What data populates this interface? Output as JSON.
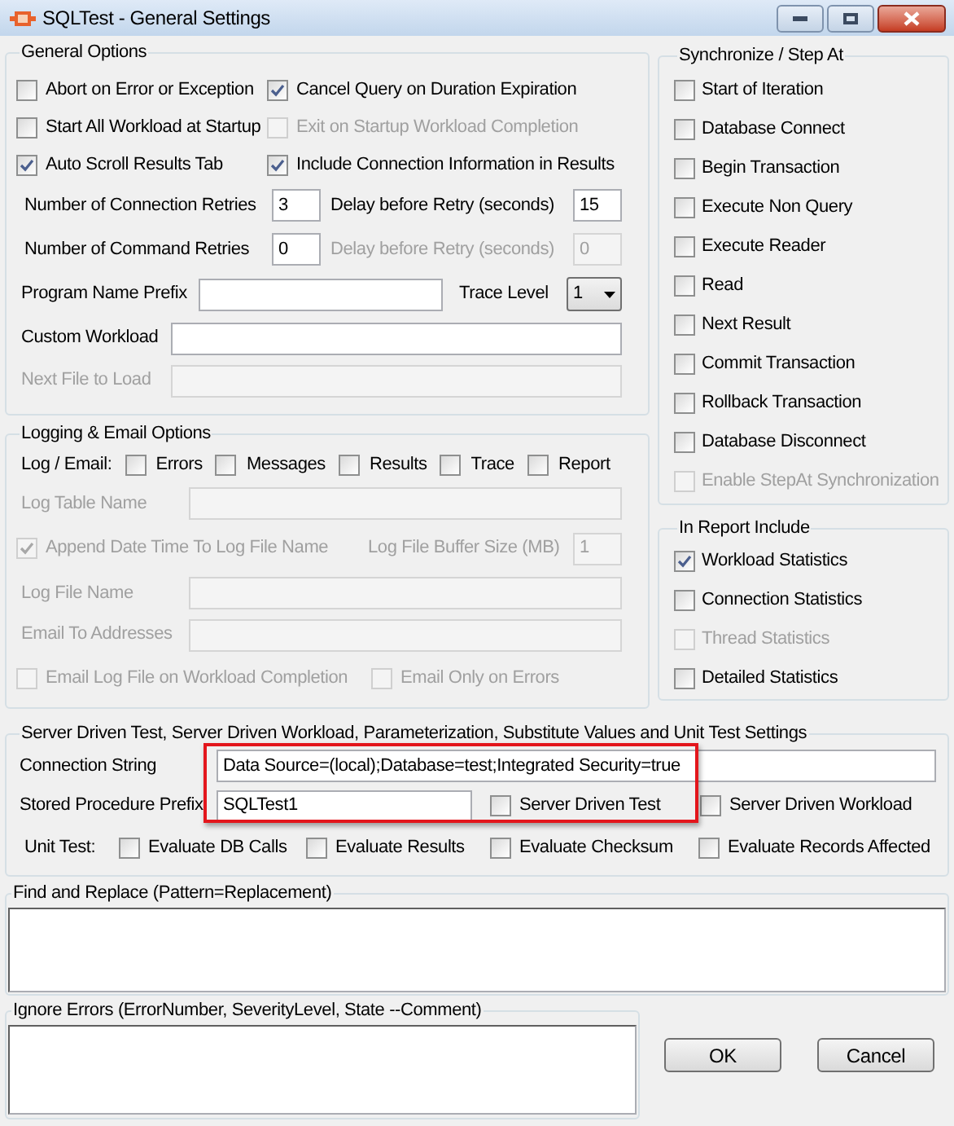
{
  "window": {
    "title": "SQLTest - General Settings"
  },
  "general_options": {
    "title": "General Options",
    "checkboxes": [
      {
        "label": "Abort on Error or Exception",
        "checked": false,
        "disabled": false
      },
      {
        "label": "Cancel Query on Duration Expiration",
        "checked": true,
        "disabled": false
      },
      {
        "label": "Start All Workload at Startup",
        "checked": false,
        "disabled": false
      },
      {
        "label": "Exit on Startup Workload Completion",
        "checked": false,
        "disabled": true
      },
      {
        "label": "Auto Scroll Results Tab",
        "checked": true,
        "disabled": false
      },
      {
        "label": "Include Connection Information in Results",
        "checked": true,
        "disabled": false
      }
    ],
    "connection_retries": {
      "label": "Number of Connection Retries",
      "value": "3",
      "disabled": false
    },
    "connection_retry_delay": {
      "label": "Delay before Retry (seconds)",
      "value": "15",
      "disabled": false
    },
    "command_retries": {
      "label": "Number of Command Retries",
      "value": "0",
      "disabled": false
    },
    "command_retry_delay": {
      "label": "Delay before Retry (seconds)",
      "value": "0",
      "disabled": true
    },
    "program_name_prefix": {
      "label": "Program Name Prefix",
      "disabled": false
    },
    "trace_level": {
      "label": "Trace Level",
      "value": "1"
    },
    "custom_workload": {
      "label": "Custom Workload",
      "disabled": false
    },
    "next_file_to_load": {
      "label": "Next File to Load",
      "disabled": true
    }
  },
  "logging": {
    "title": "Logging & Email Options",
    "log_email": {
      "label": "Log / Email:",
      "options": [
        {
          "label": "Errors",
          "checked": false,
          "disabled": false
        },
        {
          "label": "Messages",
          "checked": false,
          "disabled": false
        },
        {
          "label": "Results",
          "checked": false,
          "disabled": false
        },
        {
          "label": "Trace",
          "checked": false,
          "disabled": false
        },
        {
          "label": "Report",
          "checked": false,
          "disabled": false
        }
      ]
    },
    "log_table_name": {
      "label": "Log Table Name",
      "disabled": true
    },
    "append_date_time": {
      "label": "Append Date Time To Log File Name",
      "checked": true,
      "disabled": true
    },
    "log_file_buffer_size": {
      "label": "Log File Buffer Size (MB)",
      "value": "1",
      "disabled": true
    },
    "log_file_name": {
      "label": "Log File Name",
      "disabled": true
    },
    "email_to_addresses": {
      "label": "Email To Addresses",
      "disabled": true
    },
    "email_log_file": {
      "label": "Email Log File on Workload Completion",
      "checked": false,
      "disabled": true
    },
    "email_only_on_errors": {
      "label": "Email Only on Errors",
      "checked": false,
      "disabled": true
    }
  },
  "synchronize": {
    "title": "Synchronize / Step At",
    "items": [
      {
        "label": "Start of Iteration",
        "checked": false,
        "disabled": false
      },
      {
        "label": "Database Connect",
        "checked": false,
        "disabled": false
      },
      {
        "label": "Begin Transaction",
        "checked": false,
        "disabled": false
      },
      {
        "label": "Execute Non Query",
        "checked": false,
        "disabled": false
      },
      {
        "label": "Execute Reader",
        "checked": false,
        "disabled": false
      },
      {
        "label": "Read",
        "checked": false,
        "disabled": false
      },
      {
        "label": "Next Result",
        "checked": false,
        "disabled": false
      },
      {
        "label": "Commit Transaction",
        "checked": false,
        "disabled": false
      },
      {
        "label": "Rollback Transaction",
        "checked": false,
        "disabled": false
      },
      {
        "label": "Database Disconnect",
        "checked": false,
        "disabled": false
      },
      {
        "label": "Enable StepAt Synchronization",
        "checked": false,
        "disabled": true
      }
    ]
  },
  "report_include": {
    "title": "In Report Include",
    "items": [
      {
        "label": "Workload Statistics",
        "checked": true,
        "disabled": false
      },
      {
        "label": "Connection Statistics",
        "checked": false,
        "disabled": false
      },
      {
        "label": "Thread Statistics",
        "checked": false,
        "disabled": true
      },
      {
        "label": "Detailed Statistics",
        "checked": false,
        "disabled": false
      }
    ]
  },
  "server_driven": {
    "title": "Server Driven Test, Server Driven Workload, Parameterization, Substitute Values and Unit Test Settings",
    "connection_string": {
      "label": "Connection String",
      "value": "Data Source=(local);Database=test;Integrated Security=true",
      "disabled": false
    },
    "stored_procedure_prefix": {
      "label": "Stored Procedure Prefix",
      "value": "SQLTest1",
      "disabled": false
    },
    "server_driven_test": {
      "label": "Server Driven Test",
      "checked": false,
      "disabled": false
    },
    "server_driven_workload": {
      "label": "Server Driven Workload",
      "checked": false,
      "disabled": false
    },
    "unit_test": {
      "label": "Unit Test:",
      "options": [
        {
          "label": "Evaluate DB Calls",
          "checked": false,
          "disabled": false
        },
        {
          "label": "Evaluate Results",
          "checked": false,
          "disabled": false
        },
        {
          "label": "Evaluate Checksum",
          "checked": false,
          "disabled": false
        },
        {
          "label": "Evaluate Records Affected",
          "checked": false,
          "disabled": false
        }
      ]
    }
  },
  "find_and_replace": {
    "title": "Find and Replace (Pattern=Replacement)"
  },
  "ignore_errors": {
    "title": "Ignore Errors (ErrorNumber, SeverityLevel, State --Comment)"
  },
  "buttons": [
    "OK",
    "Cancel"
  ]
}
